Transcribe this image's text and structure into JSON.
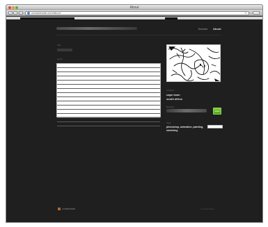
{
  "window": {
    "title": "About",
    "url": "curtainmade.com/about"
  },
  "header": {
    "site_name": "curtainmade",
    "nav": [
      {
        "label": "Browse"
      },
      {
        "label": "About"
      }
    ]
  },
  "form": {
    "title_label": "Title",
    "title_value": "untitled",
    "lyrics_label": "Lyrics",
    "lyrics_line_count": 15
  },
  "sidebar": {
    "location_label": "Location",
    "location_lines": [
      "cape town",
      "south africa"
    ],
    "drawing_label": "Drawing",
    "drawing_button": "Upload",
    "tags_label": "Tags",
    "tags_lines": [
      "photoshop, animation, painting,",
      "sketching"
    ]
  },
  "footer": {
    "logo_text": "curtainmade",
    "right_text": "© curtainmade"
  },
  "colors": {
    "page_bg": "#1f1f1f",
    "accent_green": "#5fb52a",
    "text_light": "#e4e4e4"
  }
}
